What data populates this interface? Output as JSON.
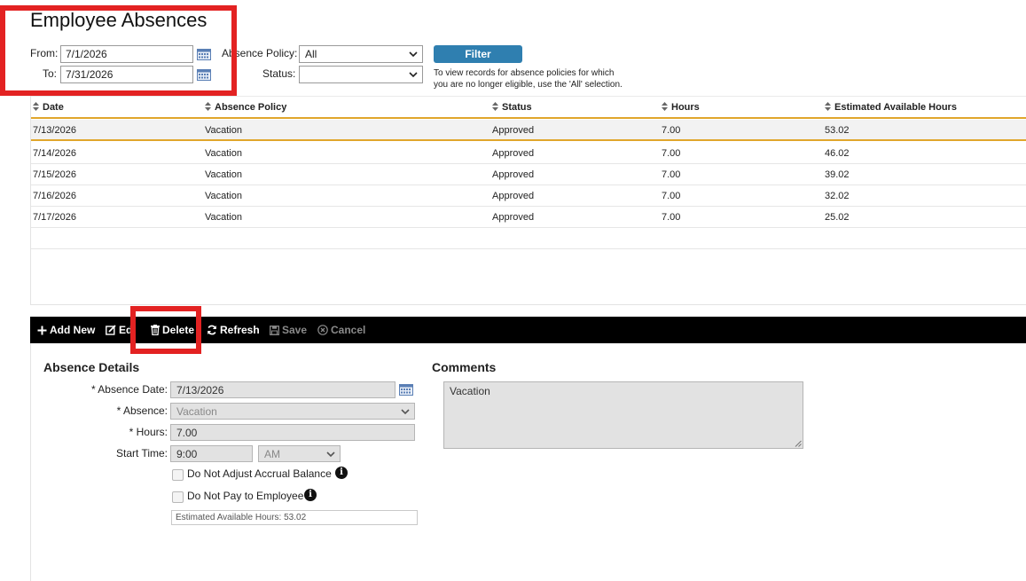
{
  "page": {
    "title": "Employee Absences"
  },
  "filters": {
    "from_label": "From:",
    "from_value": "7/1/2026",
    "to_label": "To:",
    "to_value": "7/31/2026",
    "policy_label": "Absence Policy:",
    "policy_value": "All",
    "status_label": "Status:",
    "status_value": "",
    "filter_button": "Filter",
    "hint_line1": "To view records for absence policies for which",
    "hint_line2": "you are no longer eligible, use the 'All' selection."
  },
  "grid": {
    "columns": [
      "Date",
      "Absence Policy",
      "Status",
      "Hours",
      "Estimated Available Hours"
    ],
    "rows": [
      {
        "date": "7/13/2026",
        "policy": "Vacation",
        "status": "Approved",
        "hours": "7.00",
        "est": "53.02"
      },
      {
        "date": "7/14/2026",
        "policy": "Vacation",
        "status": "Approved",
        "hours": "7.00",
        "est": "46.02"
      },
      {
        "date": "7/15/2026",
        "policy": "Vacation",
        "status": "Approved",
        "hours": "7.00",
        "est": "39.02"
      },
      {
        "date": "7/16/2026",
        "policy": "Vacation",
        "status": "Approved",
        "hours": "7.00",
        "est": "32.02"
      },
      {
        "date": "7/17/2026",
        "policy": "Vacation",
        "status": "Approved",
        "hours": "7.00",
        "est": "25.02"
      }
    ]
  },
  "toolbar": {
    "add_new": "Add New",
    "edit": "Ed",
    "delete": "Delete",
    "refresh": "Refresh",
    "save": "Save",
    "cancel": "Cancel"
  },
  "details": {
    "section_title": "Absence Details",
    "absence_date_label": "* Absence Date:",
    "absence_date_value": "7/13/2026",
    "absence_label": "* Absence:",
    "absence_value": "Vacation",
    "hours_label": "* Hours:",
    "hours_value": "7.00",
    "start_time_label": "Start Time:",
    "start_time_value": "9:00",
    "ampm_value": "AM",
    "no_adjust_label": "Do Not Adjust Accrual Balance",
    "no_pay_label": "Do Not Pay to Employee",
    "estimated_text": "Estimated Available Hours: 53.02"
  },
  "comments": {
    "section_title": "Comments",
    "value": "Vacation"
  },
  "colors": {
    "filter_button": "#2f7fb0",
    "highlight_box": "#e32222",
    "grid_accent": "#e0a62c",
    "toolbar_bg": "#000000"
  },
  "icons": [
    "calendar-icon",
    "chevron-down-icon",
    "sort-icon",
    "plus-icon",
    "edit-icon",
    "trash-icon",
    "refresh-icon",
    "save-icon",
    "cancel-icon",
    "info-icon"
  ]
}
